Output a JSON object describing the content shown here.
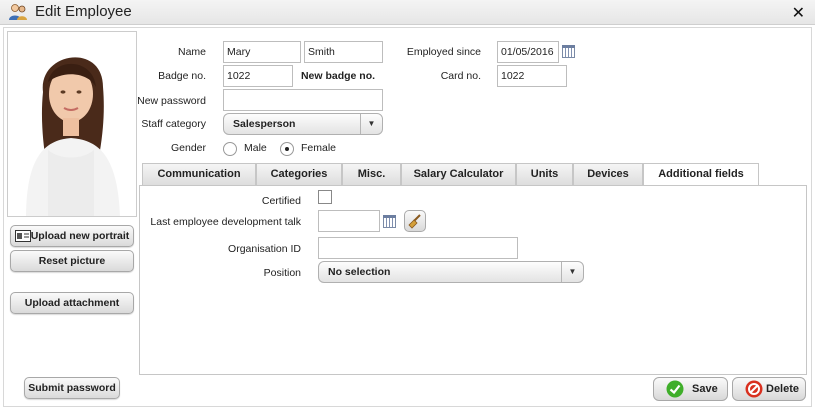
{
  "window": {
    "title": "Edit Employee",
    "close_glyph": "✕"
  },
  "left": {
    "upload_portrait": "Upload new portrait",
    "reset_picture": "Reset picture",
    "upload_attachment": "Upload attachment",
    "submit_password": "Submit password"
  },
  "form": {
    "name_label": "Name",
    "first_name": "Mary",
    "last_name": "Smith",
    "badge_label": "Badge no.",
    "badge_value": "1022",
    "new_badge_label": "New badge no.",
    "password_label": "New password",
    "password_value": "",
    "staff_label": "Staff category",
    "staff_value": "Salesperson",
    "gender_label": "Gender",
    "gender_male": "Male",
    "gender_female": "Female",
    "gender_selected": "Female",
    "employed_label": "Employed since",
    "employed_value": "01/05/2016",
    "card_label": "Card no.",
    "card_value": "1022"
  },
  "tabs": [
    {
      "label": "Communication",
      "active": false
    },
    {
      "label": "Categories",
      "active": false
    },
    {
      "label": "Misc.",
      "active": false
    },
    {
      "label": "Salary Calculator",
      "active": false
    },
    {
      "label": "Units",
      "active": false
    },
    {
      "label": "Devices",
      "active": false
    },
    {
      "label": "Additional fields",
      "active": true
    }
  ],
  "additional": {
    "certified_label": "Certified",
    "certified_checked": false,
    "dev_talk_label": "Last employee development talk",
    "dev_talk_value": "",
    "org_id_label": "Organisation ID",
    "org_id_value": "",
    "position_label": "Position",
    "position_value": "No selection"
  },
  "actions": {
    "save": "Save",
    "delete": "Delete"
  },
  "colors": {
    "save_green": "#3fae2a",
    "delete_red": "#d9301f",
    "select_bg": "#e3e3e3"
  },
  "icons": [
    "employee-icon",
    "close-icon",
    "portrait-card-icon",
    "calendar-icon",
    "broom-icon",
    "chevron-down-icon",
    "check-circle-icon",
    "forbidden-circle-icon"
  ]
}
